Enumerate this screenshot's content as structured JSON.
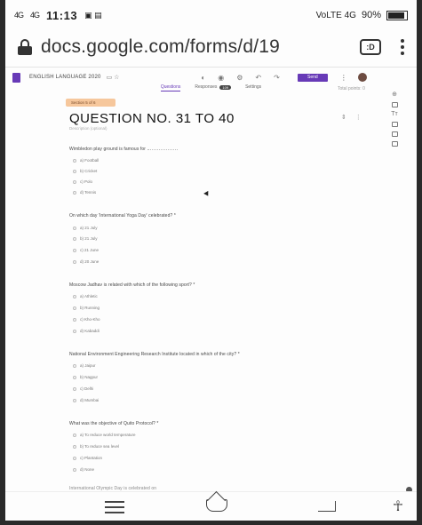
{
  "status_bar": {
    "left_signal_1": "4G",
    "left_signal_2": "4G",
    "time": "11:13",
    "right_info": "VoLTE 4G",
    "battery": "90%"
  },
  "browser": {
    "url": "docs.google.com/forms/d/19",
    "tabs_label": ":D"
  },
  "forms_header": {
    "doc_title": "ENGLISH LANGUAGE 2020",
    "send_label": "Send",
    "tabs": [
      {
        "label": "Questions",
        "badge": ""
      },
      {
        "label": "Responses",
        "badge": "109"
      },
      {
        "label": "Settings",
        "badge": ""
      }
    ],
    "preview_text": "Total points: 0"
  },
  "section": {
    "tag": "Section 5 of 6",
    "title": "QUESTION NO. 31 TO 40",
    "description": "Description (optional)"
  },
  "questions": [
    {
      "text": "Wimbledon play ground is famous for",
      "has_blank": true,
      "options": [
        "a) Football",
        "b) Cricket",
        "c) Polo",
        "d) Tennis"
      ]
    },
    {
      "text": "On which day 'International Yoga Day' celebrated? *",
      "has_blank": false,
      "options": [
        "a) 21 July",
        "b) 21 July",
        "c) 21 June",
        "d) 20 June"
      ]
    },
    {
      "text": "Moscow Jadhav is related with which of the following sport? *",
      "has_blank": false,
      "options": [
        "a) Athletic",
        "b) Running",
        "c) Kho-Kho",
        "d) Kabaddi"
      ]
    },
    {
      "text": "National Environment Engineering Research Institute located in which of the city? *",
      "has_blank": false,
      "options": [
        "a) Jaipur",
        "b) Nagpur",
        "c) Delhi",
        "d) Mumbai"
      ]
    },
    {
      "text": "What was the objective of Quito Protocol? *",
      "has_blank": false,
      "options": [
        "a) To reduce world temperature",
        "b) To reduce sea level",
        "c) Plantation",
        "d) None"
      ]
    }
  ],
  "partial_question": "International Olympic Day is celebrated on"
}
